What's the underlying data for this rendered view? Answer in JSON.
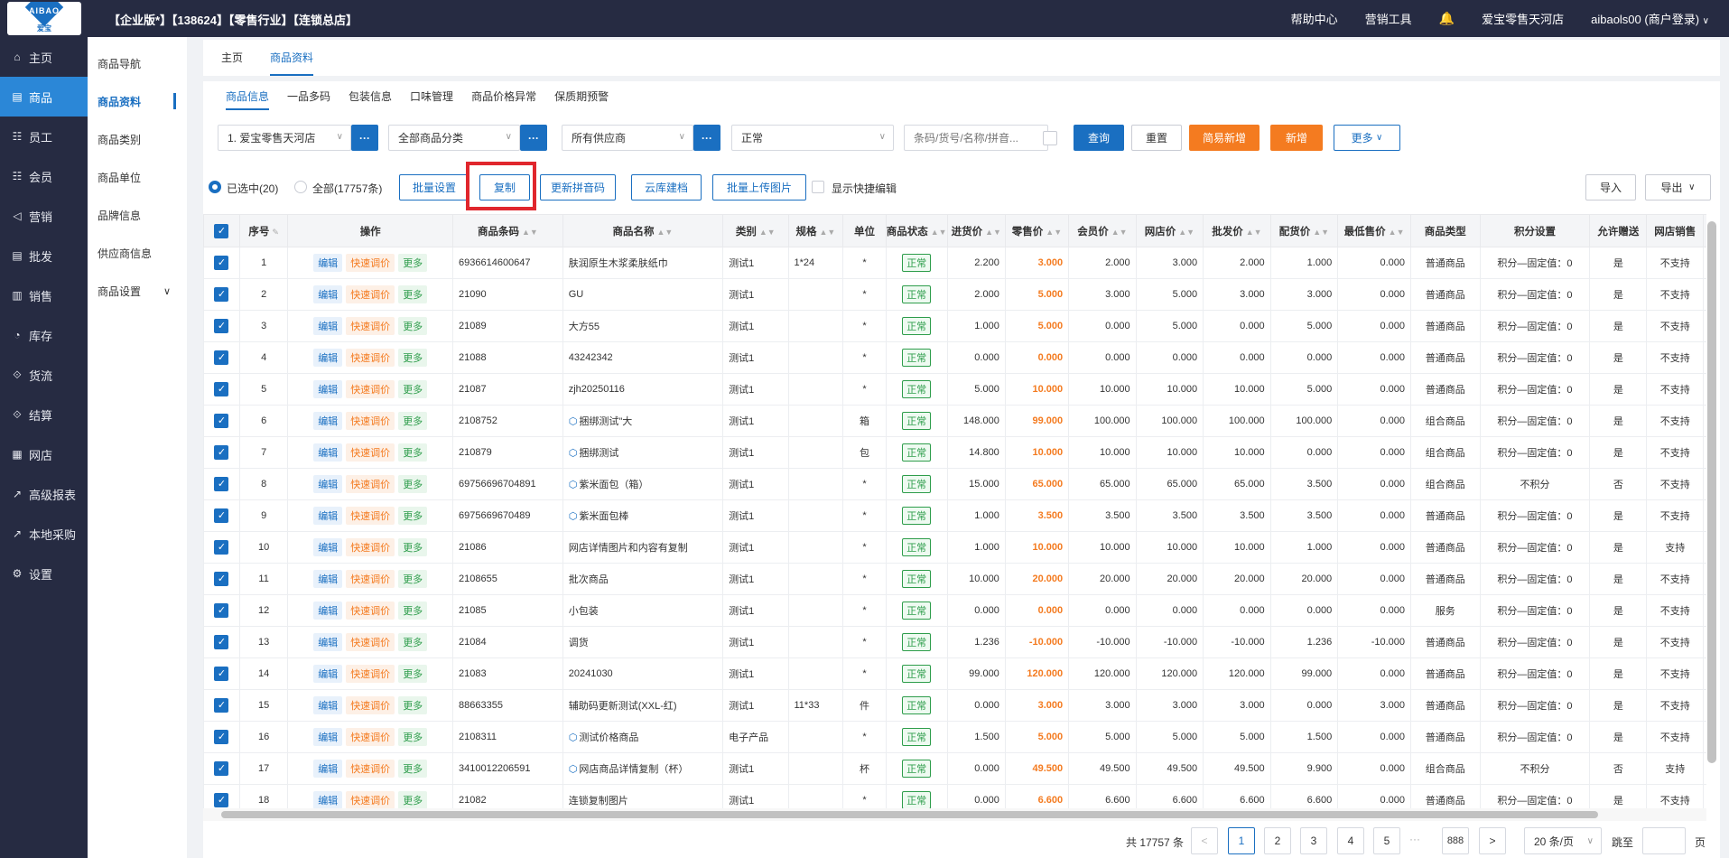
{
  "header": {
    "logo_text": "AIBAO",
    "logo_sub": "爱宝",
    "title": "【企业版*】【138624】【零售行业】【连锁总店】",
    "links": [
      "帮助中心",
      "营销工具"
    ],
    "store": "爱宝零售天河店",
    "user": "aibaols00 (商户登录)"
  },
  "sidebar": {
    "items": [
      {
        "icon": "⌂",
        "label": "主页"
      },
      {
        "icon": "▤",
        "label": "商品"
      },
      {
        "icon": "☷",
        "label": "员工"
      },
      {
        "icon": "☷",
        "label": "会员"
      },
      {
        "icon": "◁",
        "label": "营销"
      },
      {
        "icon": "▤",
        "label": "批发"
      },
      {
        "icon": "▥",
        "label": "销售"
      },
      {
        "icon": "◔",
        "label": "库存"
      },
      {
        "icon": "⟐",
        "label": "货流"
      },
      {
        "icon": "⟐",
        "label": "结算"
      },
      {
        "icon": "▦",
        "label": "网店"
      },
      {
        "icon": "↗",
        "label": "高级报表"
      },
      {
        "icon": "↗",
        "label": "本地采购"
      },
      {
        "icon": "⚙",
        "label": "设置"
      }
    ]
  },
  "subnav": {
    "items": [
      "商品导航",
      "商品资料",
      "商品类别",
      "商品单位",
      "品牌信息",
      "供应商信息",
      "商品设置"
    ]
  },
  "tabs_top": [
    "主页",
    "商品资料"
  ],
  "subtabs": [
    "商品信息",
    "一品多码",
    "包装信息",
    "口味管理",
    "商品价格异常",
    "保质期预警"
  ],
  "filters": {
    "store": "1. 爱宝零售天河店",
    "category": "全部商品分类",
    "supplier": "所有供应商",
    "status": "正常",
    "search_placeholder": "条码/货号/名称/拼音...",
    "dots": "···"
  },
  "buttons": {
    "query": "查询",
    "reset": "重置",
    "simple_add": "简易新增",
    "add": "新增",
    "more": "更多",
    "batch_setting": "批量设置",
    "copy": "复制",
    "update_pinyin": "更新拼音码",
    "cloud_build": "云库建档",
    "batch_upload": "批量上传图片",
    "quick_edit": "显示快捷编辑",
    "import": "导入",
    "export": "导出"
  },
  "selection": {
    "selected": "已选中(20)",
    "all": "全部(17757条)"
  },
  "table": {
    "columns": [
      "序号",
      "操作",
      "商品条码",
      "商品名称",
      "类别",
      "规格",
      "单位",
      "商品状态",
      "进货价",
      "零售价",
      "会员价",
      "网店价",
      "批发价",
      "配货价",
      "最低售价",
      "商品类型",
      "积分设置",
      "允许赠送",
      "网店销售"
    ],
    "ops": {
      "edit": "编辑",
      "adjust": "快速调价",
      "more": "更多"
    },
    "rows": [
      {
        "no": "1",
        "code": "6936614600647",
        "name": "肤润原生木浆柔肤纸巾",
        "pkg": false,
        "cat": "测试1",
        "spec": "1*24",
        "unit": "*",
        "status": "正常",
        "cost": "2.200",
        "retail": "3.000",
        "member": "2.000",
        "online": "3.000",
        "wholesale": "2.000",
        "dist": "1.000",
        "min": "0.000",
        "type": "普通商品",
        "points": "积分—固定值：0",
        "gift": "是",
        "sale": "不支持"
      },
      {
        "no": "2",
        "code": "21090",
        "name": "GU",
        "pkg": false,
        "cat": "测试1",
        "spec": "",
        "unit": "*",
        "status": "正常",
        "cost": "2.000",
        "retail": "5.000",
        "member": "3.000",
        "online": "5.000",
        "wholesale": "3.000",
        "dist": "3.000",
        "min": "0.000",
        "type": "普通商品",
        "points": "积分—固定值：0",
        "gift": "是",
        "sale": "不支持"
      },
      {
        "no": "3",
        "code": "21089",
        "name": "大方55",
        "pkg": false,
        "cat": "测试1",
        "spec": "",
        "unit": "*",
        "status": "正常",
        "cost": "1.000",
        "retail": "5.000",
        "member": "0.000",
        "online": "5.000",
        "wholesale": "0.000",
        "dist": "5.000",
        "min": "0.000",
        "type": "普通商品",
        "points": "积分—固定值：0",
        "gift": "是",
        "sale": "不支持"
      },
      {
        "no": "4",
        "code": "21088",
        "name": "43242342",
        "pkg": false,
        "cat": "测试1",
        "spec": "",
        "unit": "*",
        "status": "正常",
        "cost": "0.000",
        "retail": "0.000",
        "member": "0.000",
        "online": "0.000",
        "wholesale": "0.000",
        "dist": "0.000",
        "min": "0.000",
        "type": "普通商品",
        "points": "积分—固定值：0",
        "gift": "是",
        "sale": "不支持"
      },
      {
        "no": "5",
        "code": "21087",
        "name": "zjh20250116",
        "pkg": false,
        "cat": "测试1",
        "spec": "",
        "unit": "*",
        "status": "正常",
        "cost": "5.000",
        "retail": "10.000",
        "member": "10.000",
        "online": "10.000",
        "wholesale": "10.000",
        "dist": "5.000",
        "min": "0.000",
        "type": "普通商品",
        "points": "积分—固定值：0",
        "gift": "是",
        "sale": "不支持"
      },
      {
        "no": "6",
        "code": "2108752",
        "name": "捆绑测试\"大",
        "pkg": true,
        "cat": "测试1",
        "spec": "",
        "unit": "箱",
        "status": "正常",
        "cost": "148.000",
        "retail": "99.000",
        "member": "100.000",
        "online": "100.000",
        "wholesale": "100.000",
        "dist": "100.000",
        "min": "0.000",
        "type": "组合商品",
        "points": "积分—固定值：0",
        "gift": "是",
        "sale": "不支持"
      },
      {
        "no": "7",
        "code": "210879",
        "name": "捆绑测试",
        "pkg": true,
        "cat": "测试1",
        "spec": "",
        "unit": "包",
        "status": "正常",
        "cost": "14.800",
        "retail": "10.000",
        "member": "10.000",
        "online": "10.000",
        "wholesale": "10.000",
        "dist": "0.000",
        "min": "0.000",
        "type": "组合商品",
        "points": "积分—固定值：0",
        "gift": "是",
        "sale": "不支持"
      },
      {
        "no": "8",
        "code": "69756696704891",
        "name": "紫米面包（箱）",
        "pkg": true,
        "cat": "测试1",
        "spec": "",
        "unit": "*",
        "status": "正常",
        "cost": "15.000",
        "retail": "65.000",
        "member": "65.000",
        "online": "65.000",
        "wholesale": "65.000",
        "dist": "3.500",
        "min": "0.000",
        "type": "组合商品",
        "points": "不积分",
        "gift": "否",
        "sale": "不支持"
      },
      {
        "no": "9",
        "code": "6975669670489",
        "name": "紫米面包棒",
        "pkg": true,
        "cat": "测试1",
        "spec": "",
        "unit": "*",
        "status": "正常",
        "cost": "1.000",
        "retail": "3.500",
        "member": "3.500",
        "online": "3.500",
        "wholesale": "3.500",
        "dist": "3.500",
        "min": "0.000",
        "type": "普通商品",
        "points": "积分—固定值：0",
        "gift": "是",
        "sale": "不支持"
      },
      {
        "no": "10",
        "code": "21086",
        "name": "网店详情图片和内容有复制",
        "pkg": false,
        "cat": "测试1",
        "spec": "",
        "unit": "*",
        "status": "正常",
        "cost": "1.000",
        "retail": "10.000",
        "member": "10.000",
        "online": "10.000",
        "wholesale": "10.000",
        "dist": "1.000",
        "min": "0.000",
        "type": "普通商品",
        "points": "积分—固定值：0",
        "gift": "是",
        "sale": "支持"
      },
      {
        "no": "11",
        "code": "2108655",
        "name": "批次商品",
        "pkg": false,
        "cat": "测试1",
        "spec": "",
        "unit": "*",
        "status": "正常",
        "cost": "10.000",
        "retail": "20.000",
        "member": "20.000",
        "online": "20.000",
        "wholesale": "20.000",
        "dist": "20.000",
        "min": "0.000",
        "type": "普通商品",
        "points": "积分—固定值：0",
        "gift": "是",
        "sale": "不支持"
      },
      {
        "no": "12",
        "code": "21085",
        "name": "小包装",
        "pkg": false,
        "cat": "测试1",
        "spec": "",
        "unit": "*",
        "status": "正常",
        "cost": "0.000",
        "retail": "0.000",
        "member": "0.000",
        "online": "0.000",
        "wholesale": "0.000",
        "dist": "0.000",
        "min": "0.000",
        "type": "服务",
        "points": "积分—固定值：0",
        "gift": "是",
        "sale": "不支持"
      },
      {
        "no": "13",
        "code": "21084",
        "name": "调货",
        "pkg": false,
        "cat": "测试1",
        "spec": "",
        "unit": "*",
        "status": "正常",
        "cost": "1.236",
        "retail": "-10.000",
        "member": "-10.000",
        "online": "-10.000",
        "wholesale": "-10.000",
        "dist": "1.236",
        "min": "-10.000",
        "type": "普通商品",
        "points": "积分—固定值：0",
        "gift": "是",
        "sale": "不支持"
      },
      {
        "no": "14",
        "code": "21083",
        "name": "20241030",
        "pkg": false,
        "cat": "测试1",
        "spec": "",
        "unit": "*",
        "status": "正常",
        "cost": "99.000",
        "retail": "120.000",
        "member": "120.000",
        "online": "120.000",
        "wholesale": "120.000",
        "dist": "99.000",
        "min": "0.000",
        "type": "普通商品",
        "points": "积分—固定值：0",
        "gift": "是",
        "sale": "不支持"
      },
      {
        "no": "15",
        "code": "88663355",
        "name": "辅助码更新测试(XXL-红)",
        "pkg": false,
        "cat": "测试1",
        "spec": "11*33",
        "unit": "件",
        "status": "正常",
        "cost": "0.000",
        "retail": "3.000",
        "member": "3.000",
        "online": "3.000",
        "wholesale": "3.000",
        "dist": "0.000",
        "min": "3.000",
        "type": "普通商品",
        "points": "积分—固定值：0",
        "gift": "是",
        "sale": "不支持"
      },
      {
        "no": "16",
        "code": "2108311",
        "name": "测试价格商品",
        "pkg": true,
        "cat": "电子产品",
        "spec": "",
        "unit": "*",
        "status": "正常",
        "cost": "1.500",
        "retail": "5.000",
        "member": "5.000",
        "online": "5.000",
        "wholesale": "5.000",
        "dist": "1.500",
        "min": "0.000",
        "type": "普通商品",
        "points": "积分—固定值：0",
        "gift": "是",
        "sale": "不支持"
      },
      {
        "no": "17",
        "code": "3410012206591",
        "name": "网店商品详情复制（杯）",
        "pkg": true,
        "cat": "测试1",
        "spec": "",
        "unit": "杯",
        "status": "正常",
        "cost": "0.000",
        "retail": "49.500",
        "member": "49.500",
        "online": "49.500",
        "wholesale": "49.500",
        "dist": "9.900",
        "min": "0.000",
        "type": "组合商品",
        "points": "不积分",
        "gift": "否",
        "sale": "支持"
      },
      {
        "no": "18",
        "code": "21082",
        "name": "连锁复制图片",
        "pkg": false,
        "cat": "测试1",
        "spec": "",
        "unit": "*",
        "status": "正常",
        "cost": "0.000",
        "retail": "6.600",
        "member": "6.600",
        "online": "6.600",
        "wholesale": "6.600",
        "dist": "6.600",
        "min": "0.000",
        "type": "普通商品",
        "points": "积分—固定值：0",
        "gift": "是",
        "sale": "不支持"
      }
    ]
  },
  "pager": {
    "total": "共 17757 条",
    "prev": "<",
    "pages": [
      "1",
      "2",
      "3",
      "4",
      "5"
    ],
    "ellipsis": "···",
    "last": "888",
    "next": ">",
    "size": "20 条/页",
    "jump": "跳至",
    "page_unit": "页"
  },
  "colors": {
    "accent": "#1a6fc1",
    "orange": "#f47b20",
    "highlight": "#e0262d",
    "topbar": "#262b42"
  }
}
